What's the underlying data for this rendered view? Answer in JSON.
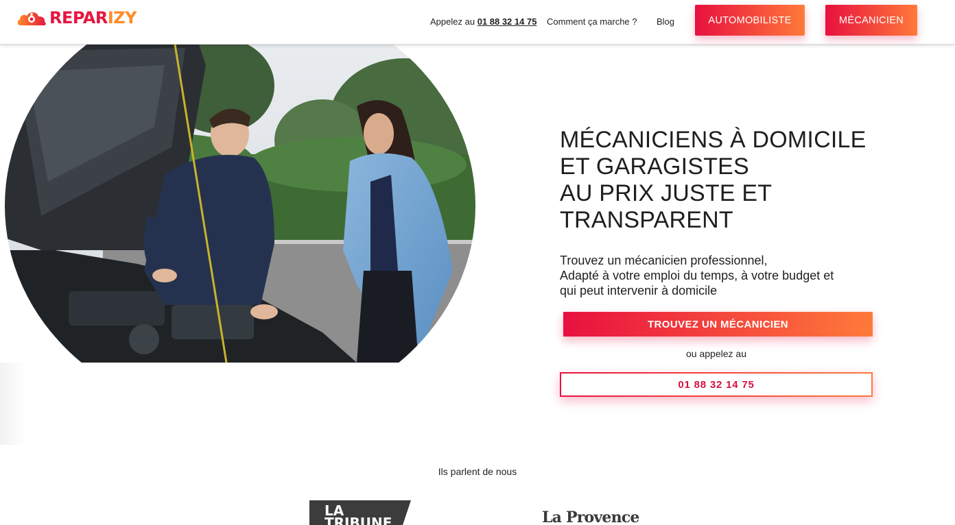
{
  "brand": {
    "logo_text_primary": "REPAR",
    "logo_text_secondary": "IZY",
    "primary_color": "#e5173f",
    "secondary_color": "#ff8c2a",
    "logo_icon": "cloud-wrench-icon"
  },
  "nav": {
    "call_prefix": "Appelez au",
    "call_phone": "01 88 32 14 75",
    "how_it_works": "Comment ça marche ?",
    "blog": "Blog",
    "btn_driver": "AUTOMOBILISTE",
    "btn_mechanic": "MÉCANICIEN"
  },
  "hero": {
    "title_lines": [
      "MÉCANICIENS À DOMICILE",
      "ET GARAGISTES",
      "AU PRIX JUSTE ET",
      "TRANSPARENT"
    ],
    "subtitle_lines": [
      "Trouvez un mécanicien professionnel,",
      "Adapté à votre emploi du temps, à votre budget et",
      "qui peut intervenir à domicile"
    ],
    "cta_label": "TROUVEZ UN MÉCANICIEN",
    "or_call_label": "ou appelez au",
    "phone_label": "01 88 32 14 75"
  },
  "press": {
    "title": "Ils parlent de nous",
    "logos": [
      {
        "name": "LA TRIBUNE",
        "line1": "LA",
        "line2": "TRIBUNE"
      },
      {
        "name": "La Provence",
        "text": "La Provence"
      }
    ]
  }
}
